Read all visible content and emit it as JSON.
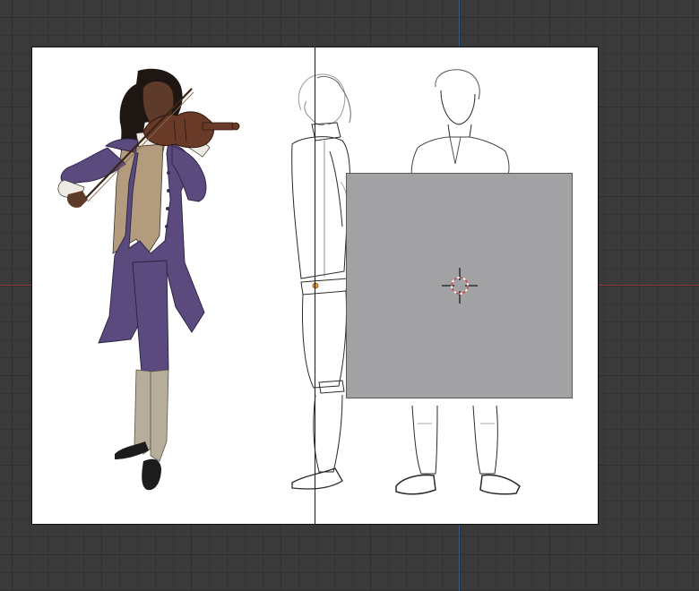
{
  "viewport": {
    "background_color": "#3a3a3a",
    "grid_color": "#2f2f2f",
    "x_axis_color": "#8a3a3a",
    "y_axis_color": "#3a5a8a"
  },
  "canvas": {
    "background_color": "#ffffff",
    "left_figure": {
      "icon": "violinist-illustration-icon",
      "coat_color": "#5a4a7e",
      "waistcoat_color": "#b39b7e",
      "stocking_color": "#b7ad9b",
      "skin_color": "#5e3a2a",
      "violin_color": "#6a3a28"
    },
    "side_sketch": {
      "icon": "side-view-sketch-icon"
    },
    "front_sketch": {
      "icon": "front-view-sketch-icon"
    }
  },
  "empty_plane": {
    "fill_color": "#a2a2a5"
  },
  "cursor_3d": {
    "icon": "3d-cursor-icon",
    "ring_color": "#d24a4a"
  }
}
